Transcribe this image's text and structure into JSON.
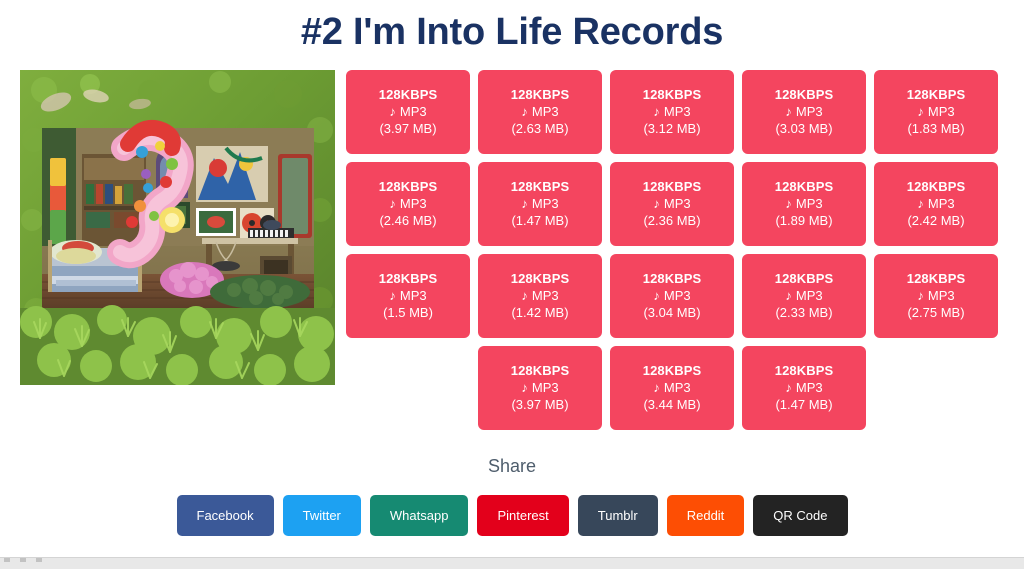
{
  "page": {
    "title": "#2 I'm Into Life Records"
  },
  "album_art": {
    "alt": "miniature-diorama-room-in-moss"
  },
  "downloads": {
    "kbps_label": "128KBPS",
    "format_label": "MP3",
    "note_icon": "♪",
    "rows": [
      [
        {
          "size": "(3.97 MB)"
        },
        {
          "size": "(2.63 MB)"
        },
        {
          "size": "(3.12 MB)"
        },
        {
          "size": "(3.03 MB)"
        },
        {
          "size": "(1.83 MB)"
        }
      ],
      [
        {
          "size": "(2.46 MB)"
        },
        {
          "size": "(1.47 MB)"
        },
        {
          "size": "(2.36 MB)"
        },
        {
          "size": "(1.89 MB)"
        },
        {
          "size": "(2.42 MB)"
        }
      ],
      [
        {
          "size": "(1.5 MB)"
        },
        {
          "size": "(1.42 MB)"
        },
        {
          "size": "(3.04 MB)"
        },
        {
          "size": "(2.33 MB)"
        },
        {
          "size": "(2.75 MB)"
        }
      ],
      [
        {
          "size": "(3.97 MB)"
        },
        {
          "size": "(3.44 MB)"
        },
        {
          "size": "(1.47 MB)"
        }
      ]
    ],
    "button_color": "#f4455f"
  },
  "share": {
    "heading": "Share",
    "buttons": [
      {
        "label": "Facebook",
        "color": "#3b5998"
      },
      {
        "label": "Twitter",
        "color": "#1da1f2"
      },
      {
        "label": "Whatsapp",
        "color": "#168a72"
      },
      {
        "label": "Pinterest",
        "color": "#e3001b"
      },
      {
        "label": "Tumblr",
        "color": "#37475a"
      },
      {
        "label": "Reddit",
        "color": "#fd4e04"
      },
      {
        "label": "QR Code",
        "color": "#232323"
      }
    ]
  },
  "theme": {
    "title_color": "#1a3263",
    "share_label_color": "#4e5d6c",
    "background": "#ffffff"
  }
}
